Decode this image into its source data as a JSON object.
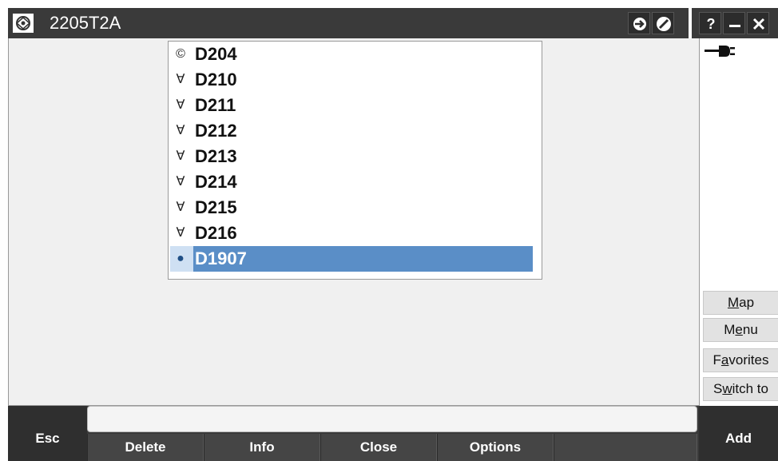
{
  "window": {
    "title": "2205T2A",
    "help_label": "?"
  },
  "list": {
    "items": [
      {
        "label": "D204",
        "icon": "control-point-icon",
        "glyph": "©"
      },
      {
        "label": "D210",
        "icon": "measured-point-icon",
        "glyph": "∀"
      },
      {
        "label": "D211",
        "icon": "measured-point-icon",
        "glyph": "∀"
      },
      {
        "label": "D212",
        "icon": "measured-point-icon",
        "glyph": "∀"
      },
      {
        "label": "D213",
        "icon": "measured-point-icon",
        "glyph": "∀"
      },
      {
        "label": "D214",
        "icon": "measured-point-icon",
        "glyph": "∀"
      },
      {
        "label": "D215",
        "icon": "measured-point-icon",
        "glyph": "∀"
      },
      {
        "label": "D216",
        "icon": "measured-point-icon",
        "glyph": "∀"
      },
      {
        "label": "D1907",
        "icon": "point-dot-icon",
        "glyph": "●",
        "selected": true
      }
    ],
    "selection_color": "#5a8ec7"
  },
  "side": {
    "map": {
      "pre": "",
      "ul": "M",
      "post": "ap"
    },
    "menu": {
      "pre": "M",
      "ul": "e",
      "post": "nu"
    },
    "favorites": {
      "pre": "F",
      "ul": "a",
      "post": "vorites"
    },
    "switch_to": {
      "pre": "S",
      "ul": "w",
      "post": "itch to"
    }
  },
  "bottom": {
    "esc": "Esc",
    "add": "Add",
    "delete": "Delete",
    "info": "Info",
    "close": "Close",
    "options": "Options",
    "status_text": ""
  }
}
